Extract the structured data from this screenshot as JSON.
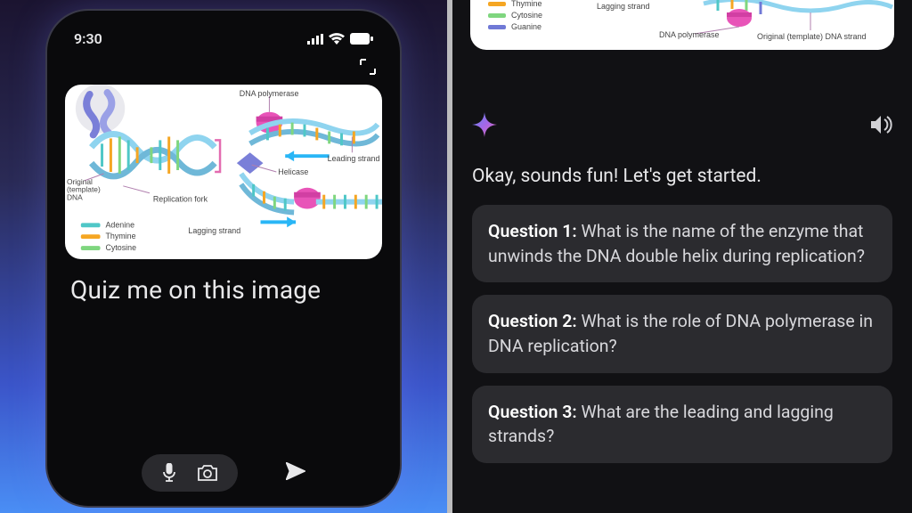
{
  "left": {
    "time": "9:30",
    "prompt": "Quiz me on this image",
    "diagram": {
      "labels": {
        "dna_polymerase": "DNA polymerase",
        "leading_strand": "Leading strand",
        "helicase": "Helicase",
        "replication_fork": "Replication fork",
        "original_template_dna": "Original (template) DNA",
        "lagging_strand": "Lagging strand"
      },
      "legend": {
        "adenine": "Adenine",
        "thymine": "Thymine",
        "cytosine": "Cytosine"
      }
    }
  },
  "right": {
    "mini_diagram": {
      "labels": {
        "lagging_strand": "Lagging strand",
        "dna_polymerase": "DNA polymerase",
        "original_template": "Original (template) DNA strand"
      },
      "legend": {
        "thymine": "Thymine",
        "cytosine": "Cytosine",
        "guanine": "Guanine"
      }
    },
    "intro": "Okay, sounds fun! Let's get started.",
    "questions": [
      {
        "label": "Question 1:",
        "text": " What is the name of the enzyme that unwinds the DNA double helix during replication?"
      },
      {
        "label": "Question 2:",
        "text": " What is the role of DNA polymerase in DNA replication?"
      },
      {
        "label": "Question 3:",
        "text": " What are the leading and lagging strands?"
      }
    ]
  }
}
